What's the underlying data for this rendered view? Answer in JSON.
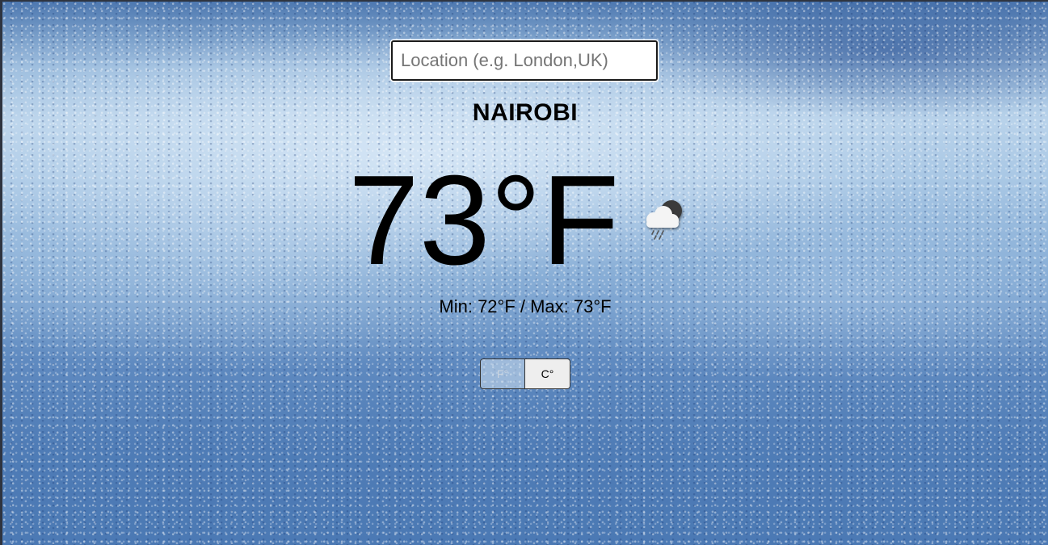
{
  "search": {
    "placeholder": "Location (e.g. London,UK)",
    "value": ""
  },
  "weather": {
    "city": "NAIROBI",
    "temperature": "73°F",
    "minmax": "Min: 72°F / Max: 73°F",
    "icon": "cloud-rain-night-icon"
  },
  "units": {
    "fahrenheit_label": "F°",
    "celsius_label": "C°",
    "active": "F"
  },
  "colors": {
    "background_rain": "#7fa7d2",
    "text": "#000000"
  }
}
